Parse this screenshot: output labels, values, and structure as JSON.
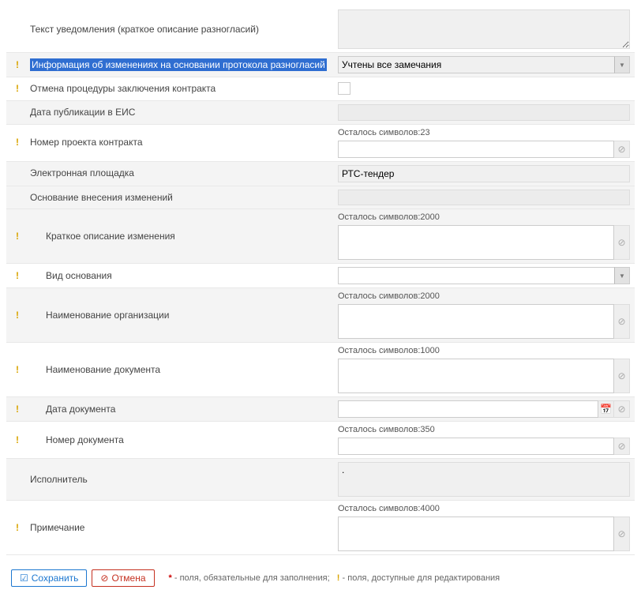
{
  "rows": {
    "notif_text": {
      "label": "Текст уведомления (краткое описание разногласий)",
      "value": ""
    },
    "changes_info": {
      "label": "Информация об изменениях на основании протокола разногласий",
      "value": "Учтены все замечания"
    },
    "cancel_proc": {
      "label": "Отмена процедуры заключения контракта"
    },
    "eis_pub_date": {
      "label": "Дата публикации в ЕИС"
    },
    "project_num": {
      "label": "Номер проекта контракта",
      "counter": "Осталось символов:23",
      "value": ""
    },
    "platform": {
      "label": "Электронная площадка",
      "value": "РТС-тендер"
    },
    "change_basis": {
      "label": "Основание внесения изменений"
    },
    "change_desc": {
      "label": "Краткое описание изменения",
      "counter": "Осталось символов:2000",
      "value": ""
    },
    "basis_type": {
      "label": "Вид основания",
      "value": ""
    },
    "org_name": {
      "label": "Наименование организации",
      "counter": "Осталось символов:2000",
      "value": ""
    },
    "doc_name": {
      "label": "Наименование документа",
      "counter": "Осталось символов:1000",
      "value": ""
    },
    "doc_date": {
      "label": "Дата документа",
      "value": ""
    },
    "doc_num": {
      "label": "Номер документа",
      "counter": "Осталось символов:350",
      "value": ""
    },
    "executor": {
      "label": "Исполнитель",
      "value": "."
    },
    "note": {
      "label": "Примечание",
      "counter": "Осталось символов:4000",
      "value": ""
    }
  },
  "buttons": {
    "save": "Сохранить",
    "cancel": "Отмена"
  },
  "legend": {
    "req": "- поля, обязательные для заполнения;",
    "edit": "- поля, доступные для редактирования"
  }
}
